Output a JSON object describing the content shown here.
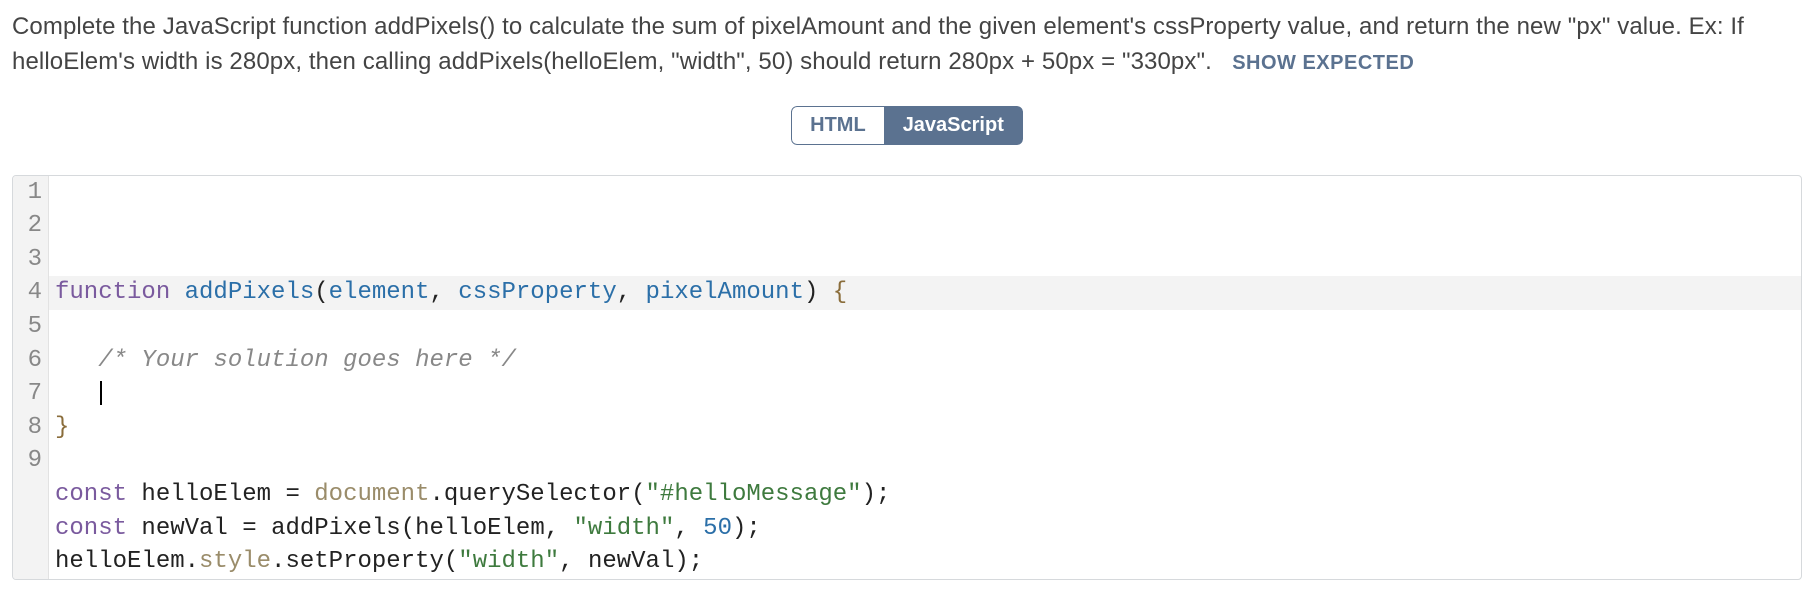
{
  "prompt": {
    "text": "Complete the JavaScript function addPixels() to calculate the sum of pixelAmount and the given element's cssProperty value, and return the new \"px\" value. Ex: If helloElem's width is 280px, then calling addPixels(helloElem, \"width\", 50) should return 280px + 50px = \"330px\".",
    "show_expected": "Show expected"
  },
  "tabs": {
    "html": "HTML",
    "javascript": "JavaScript"
  },
  "editor": {
    "language": "javascript",
    "cursor_line": 4,
    "highlighted_line": 4,
    "lines": [
      {
        "n": 1,
        "tokens": [
          {
            "t": "function ",
            "c": "kw"
          },
          {
            "t": "addPixels",
            "c": "fn"
          },
          {
            "t": "(",
            "c": "p"
          },
          {
            "t": "element",
            "c": "par"
          },
          {
            "t": ", ",
            "c": "p"
          },
          {
            "t": "cssProperty",
            "c": "par"
          },
          {
            "t": ", ",
            "c": "p"
          },
          {
            "t": "pixelAmount",
            "c": "par"
          },
          {
            "t": ") ",
            "c": "p"
          },
          {
            "t": "{",
            "c": "br"
          }
        ]
      },
      {
        "n": 2,
        "tokens": []
      },
      {
        "n": 3,
        "tokens": [
          {
            "t": "   ",
            "c": "p"
          },
          {
            "t": "/* Your solution goes here */",
            "c": "cm"
          }
        ]
      },
      {
        "n": 4,
        "tokens": [
          {
            "t": "   ",
            "c": "p"
          }
        ]
      },
      {
        "n": 5,
        "tokens": [
          {
            "t": "}",
            "c": "br"
          }
        ]
      },
      {
        "n": 6,
        "tokens": []
      },
      {
        "n": 7,
        "tokens": [
          {
            "t": "const ",
            "c": "kw"
          },
          {
            "t": "helloElem ",
            "c": "id"
          },
          {
            "t": "= ",
            "c": "p"
          },
          {
            "t": "document",
            "c": "obj"
          },
          {
            "t": ".",
            "c": "p"
          },
          {
            "t": "querySelector",
            "c": "mbr"
          },
          {
            "t": "(",
            "c": "p"
          },
          {
            "t": "\"#helloMessage\"",
            "c": "str"
          },
          {
            "t": ")",
            "c": "p"
          },
          {
            "t": ";",
            "c": "sc"
          }
        ]
      },
      {
        "n": 8,
        "tokens": [
          {
            "t": "const ",
            "c": "kw"
          },
          {
            "t": "newVal ",
            "c": "id"
          },
          {
            "t": "= ",
            "c": "p"
          },
          {
            "t": "addPixels",
            "c": "mbr"
          },
          {
            "t": "(",
            "c": "p"
          },
          {
            "t": "helloElem",
            "c": "id"
          },
          {
            "t": ", ",
            "c": "p"
          },
          {
            "t": "\"width\"",
            "c": "str"
          },
          {
            "t": ", ",
            "c": "p"
          },
          {
            "t": "50",
            "c": "num"
          },
          {
            "t": ")",
            "c": "p"
          },
          {
            "t": ";",
            "c": "sc"
          }
        ]
      },
      {
        "n": 9,
        "tokens": [
          {
            "t": "helloElem",
            "c": "id"
          },
          {
            "t": ".",
            "c": "p"
          },
          {
            "t": "style",
            "c": "prop"
          },
          {
            "t": ".",
            "c": "p"
          },
          {
            "t": "setProperty",
            "c": "mbr"
          },
          {
            "t": "(",
            "c": "p"
          },
          {
            "t": "\"width\"",
            "c": "str"
          },
          {
            "t": ", ",
            "c": "p"
          },
          {
            "t": "newVal",
            "c": "id"
          },
          {
            "t": ")",
            "c": "p"
          },
          {
            "t": ";",
            "c": "sc"
          }
        ]
      }
    ]
  }
}
